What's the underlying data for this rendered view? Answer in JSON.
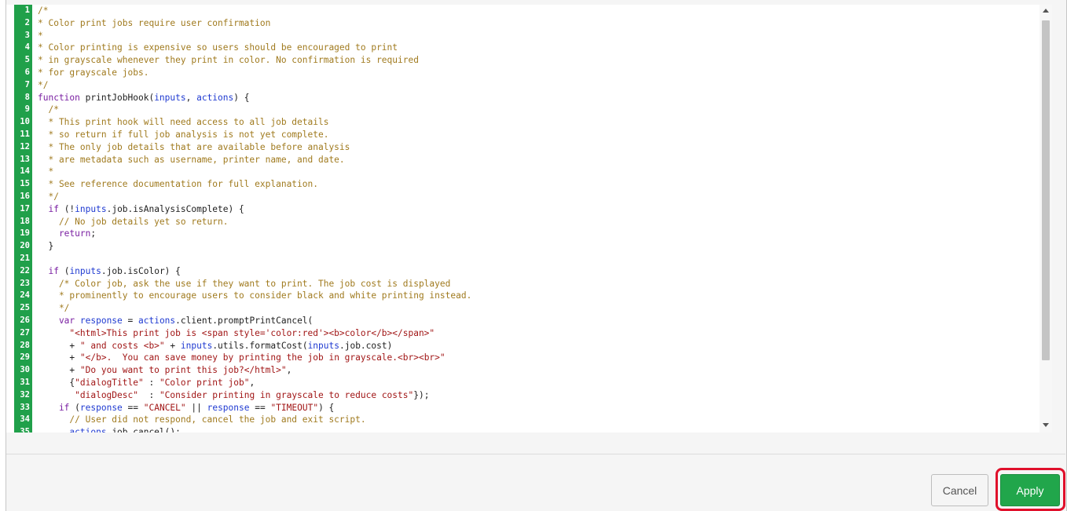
{
  "editor": {
    "lines": [
      {
        "n": "1",
        "parts": [
          {
            "c": "comment",
            "t": "/*"
          }
        ]
      },
      {
        "n": "2",
        "parts": [
          {
            "c": "comment",
            "t": "* Color print jobs require user confirmation"
          }
        ]
      },
      {
        "n": "3",
        "parts": [
          {
            "c": "comment",
            "t": "*"
          }
        ]
      },
      {
        "n": "4",
        "parts": [
          {
            "c": "comment",
            "t": "* Color printing is expensive so users should be encouraged to print"
          }
        ]
      },
      {
        "n": "5",
        "parts": [
          {
            "c": "comment",
            "t": "* in grayscale whenever they print in color. No confirmation is required"
          }
        ]
      },
      {
        "n": "6",
        "parts": [
          {
            "c": "comment",
            "t": "* for grayscale jobs."
          }
        ]
      },
      {
        "n": "7",
        "parts": [
          {
            "c": "comment",
            "t": "*/"
          }
        ]
      },
      {
        "n": "8",
        "parts": [
          {
            "c": "kw",
            "t": "function "
          },
          {
            "c": "",
            "t": "printJobHook("
          },
          {
            "c": "var",
            "t": "inputs"
          },
          {
            "c": "",
            "t": ", "
          },
          {
            "c": "var",
            "t": "actions"
          },
          {
            "c": "",
            "t": ") {"
          }
        ]
      },
      {
        "n": "9",
        "parts": [
          {
            "c": "comment",
            "t": "  /*"
          }
        ]
      },
      {
        "n": "10",
        "parts": [
          {
            "c": "comment",
            "t": "  * This print hook will need access to all job details"
          }
        ]
      },
      {
        "n": "11",
        "parts": [
          {
            "c": "comment",
            "t": "  * so return if full job analysis is not yet complete."
          }
        ]
      },
      {
        "n": "12",
        "parts": [
          {
            "c": "comment",
            "t": "  * The only job details that are available before analysis"
          }
        ]
      },
      {
        "n": "13",
        "parts": [
          {
            "c": "comment",
            "t": "  * are metadata such as username, printer name, and date."
          }
        ]
      },
      {
        "n": "14",
        "parts": [
          {
            "c": "comment",
            "t": "  *"
          }
        ]
      },
      {
        "n": "15",
        "parts": [
          {
            "c": "comment",
            "t": "  * See reference documentation for full explanation."
          }
        ]
      },
      {
        "n": "16",
        "parts": [
          {
            "c": "comment",
            "t": "  */"
          }
        ]
      },
      {
        "n": "17",
        "parts": [
          {
            "c": "kw",
            "t": "  if "
          },
          {
            "c": "",
            "t": "(!"
          },
          {
            "c": "var",
            "t": "inputs"
          },
          {
            "c": "",
            "t": ".job.isAnalysisComplete) {"
          }
        ]
      },
      {
        "n": "18",
        "parts": [
          {
            "c": "comment",
            "t": "    // No job details yet so return."
          }
        ]
      },
      {
        "n": "19",
        "parts": [
          {
            "c": "kw",
            "t": "    return"
          },
          {
            "c": "",
            "t": ";"
          }
        ]
      },
      {
        "n": "20",
        "parts": [
          {
            "c": "",
            "t": "  }"
          }
        ]
      },
      {
        "n": "21",
        "parts": [
          {
            "c": "",
            "t": ""
          }
        ]
      },
      {
        "n": "22",
        "parts": [
          {
            "c": "kw",
            "t": "  if "
          },
          {
            "c": "",
            "t": "("
          },
          {
            "c": "var",
            "t": "inputs"
          },
          {
            "c": "",
            "t": ".job.isColor) {"
          }
        ]
      },
      {
        "n": "23",
        "parts": [
          {
            "c": "comment",
            "t": "    /* Color job, ask the use if they want to print. The job cost is displayed"
          }
        ]
      },
      {
        "n": "24",
        "parts": [
          {
            "c": "comment",
            "t": "    * prominently to encourage users to consider black and white printing instead."
          }
        ]
      },
      {
        "n": "25",
        "parts": [
          {
            "c": "comment",
            "t": "    */"
          }
        ]
      },
      {
        "n": "26",
        "parts": [
          {
            "c": "kw",
            "t": "    var "
          },
          {
            "c": "var",
            "t": "response"
          },
          {
            "c": "",
            "t": " = "
          },
          {
            "c": "var",
            "t": "actions"
          },
          {
            "c": "",
            "t": ".client.promptPrintCancel("
          }
        ]
      },
      {
        "n": "27",
        "parts": [
          {
            "c": "str",
            "t": "      \"<html>This print job is <span style='color:red'><b>color</b></span>\""
          }
        ]
      },
      {
        "n": "28",
        "parts": [
          {
            "c": "",
            "t": "      + "
          },
          {
            "c": "str",
            "t": "\" and costs <b>\""
          },
          {
            "c": "",
            "t": " + "
          },
          {
            "c": "var",
            "t": "inputs"
          },
          {
            "c": "",
            "t": ".utils.formatCost("
          },
          {
            "c": "var",
            "t": "inputs"
          },
          {
            "c": "",
            "t": ".job.cost)"
          }
        ]
      },
      {
        "n": "29",
        "parts": [
          {
            "c": "",
            "t": "      + "
          },
          {
            "c": "str",
            "t": "\"</b>.  You can save money by printing the job in grayscale.<br><br>\""
          }
        ]
      },
      {
        "n": "30",
        "parts": [
          {
            "c": "",
            "t": "      + "
          },
          {
            "c": "str",
            "t": "\"Do you want to print this job?</html>\""
          },
          {
            "c": "",
            "t": ","
          }
        ]
      },
      {
        "n": "31",
        "parts": [
          {
            "c": "",
            "t": "      {"
          },
          {
            "c": "str",
            "t": "\"dialogTitle\""
          },
          {
            "c": "",
            "t": " : "
          },
          {
            "c": "str",
            "t": "\"Color print job\""
          },
          {
            "c": "",
            "t": ","
          }
        ]
      },
      {
        "n": "32",
        "parts": [
          {
            "c": "str",
            "t": "       \"dialogDesc\""
          },
          {
            "c": "",
            "t": "  : "
          },
          {
            "c": "str",
            "t": "\"Consider printing in grayscale to reduce costs\""
          },
          {
            "c": "",
            "t": "});"
          }
        ]
      },
      {
        "n": "33",
        "parts": [
          {
            "c": "kw",
            "t": "    if "
          },
          {
            "c": "",
            "t": "("
          },
          {
            "c": "var",
            "t": "response"
          },
          {
            "c": "",
            "t": " == "
          },
          {
            "c": "str",
            "t": "\"CANCEL\""
          },
          {
            "c": "",
            "t": " || "
          },
          {
            "c": "var",
            "t": "response"
          },
          {
            "c": "",
            "t": " == "
          },
          {
            "c": "str",
            "t": "\"TIMEOUT\""
          },
          {
            "c": "",
            "t": ") {"
          }
        ]
      },
      {
        "n": "34",
        "parts": [
          {
            "c": "comment",
            "t": "      // User did not respond, cancel the job and exit script."
          }
        ]
      },
      {
        "n": "35",
        "parts": [
          {
            "c": "var",
            "t": "      actions"
          },
          {
            "c": "",
            "t": ".job.cancel();"
          }
        ]
      }
    ]
  },
  "footer": {
    "cancel_label": "Cancel",
    "apply_label": "Apply"
  },
  "colors": {
    "gutter": "#20a04a",
    "apply": "#21a64b",
    "highlight": "#e0102b"
  }
}
